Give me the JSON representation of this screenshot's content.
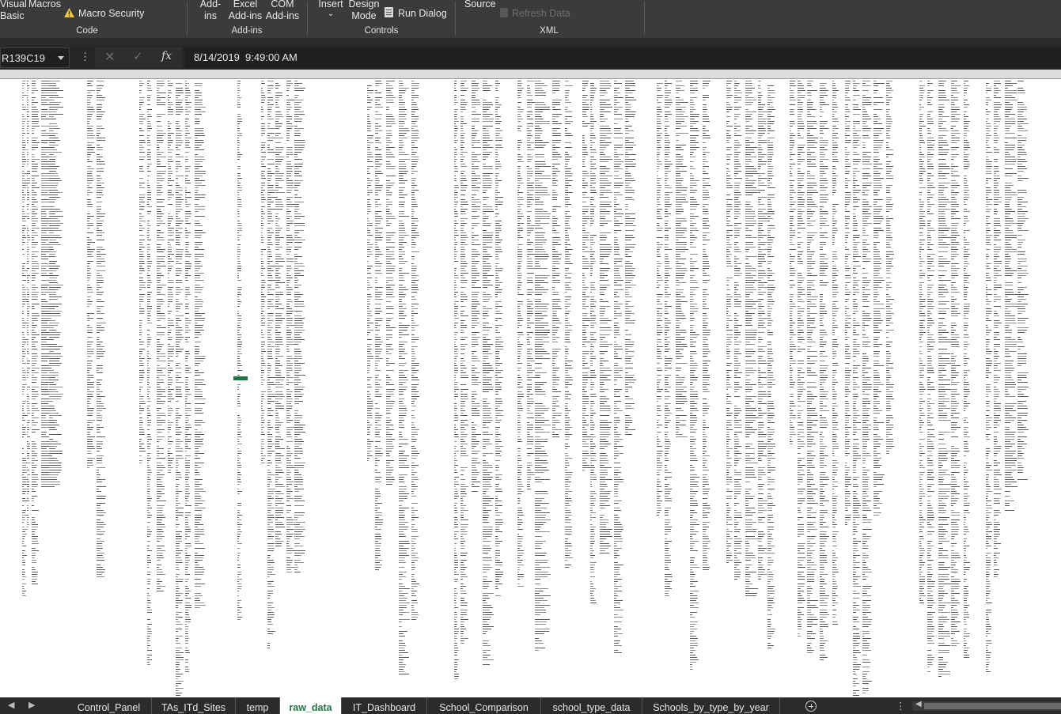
{
  "ribbon": {
    "code": {
      "visual_basic_line1": "Visual",
      "visual_basic_line2": "Basic",
      "macros": "Macros",
      "macro_security": "Macro Security",
      "group_label": "Code"
    },
    "addins": {
      "addins_line1": "Add-",
      "addins_line2": "ins",
      "excel_addins_line1": "Excel",
      "excel_addins_line2": "Add-ins",
      "com_addins_line1": "COM",
      "com_addins_line2": "Add-ins",
      "group_label": "Add-ins"
    },
    "controls": {
      "insert": "Insert",
      "insert_arrow": "⌄",
      "design_mode_line1": "Design",
      "design_mode_line2": "Mode",
      "run_dialog": "Run Dialog",
      "group_label": "Controls"
    },
    "xml": {
      "source": "Source",
      "refresh_data": "Refresh Data",
      "group_label": "XML"
    }
  },
  "formula_bar": {
    "name_box": "R139C19",
    "more_options": "⋮",
    "cancel_symbol": "✕",
    "enter_symbol": "✓",
    "fx_symbol": "fx",
    "value": "8/14/2019  9:49:00 AM"
  },
  "sheet_tabs": {
    "nav_prev": "◀",
    "nav_next": "▶",
    "tabs": [
      {
        "label": "Control_Panel",
        "active": false
      },
      {
        "label": "TAs_ITd_Sites",
        "active": false
      },
      {
        "label": "temp",
        "active": false
      },
      {
        "label": "raw_data",
        "active": true
      },
      {
        "label": "IT_Dashboard",
        "active": false
      },
      {
        "label": "School_Comparison",
        "active": false
      },
      {
        "label": "school_type_data",
        "active": false
      },
      {
        "label": "Schools_by_type_by_year",
        "active": false
      }
    ],
    "more_options": "⋮",
    "scroll_left": "◀"
  },
  "colors": {
    "ribbon_bg": "#3b3b3b",
    "formula_bg": "#262626",
    "accent_green": "#217346",
    "tab_bar_bg": "#2b2b2b"
  }
}
